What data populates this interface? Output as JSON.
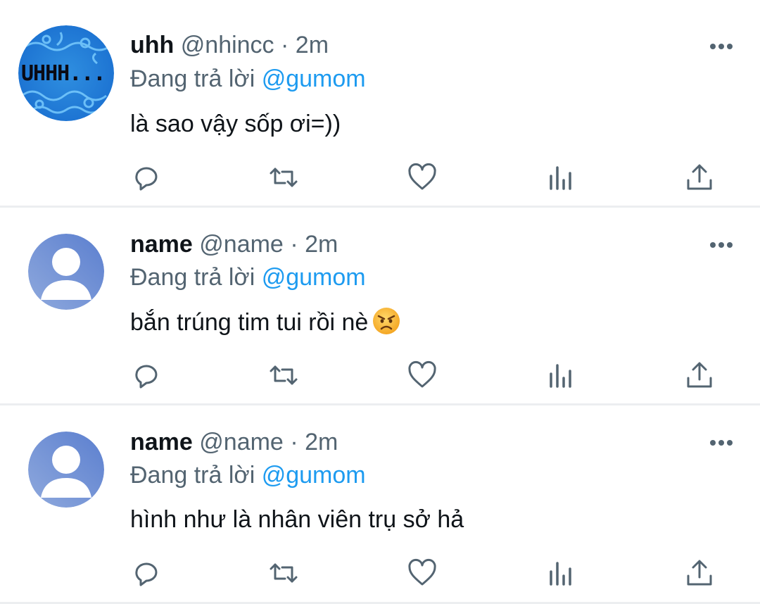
{
  "tweets": [
    {
      "display_name": "uhh",
      "handle": "@nhincc",
      "separator": "·",
      "time": "2m",
      "reply_prefix": "Đang trả lời",
      "reply_to": "@gumom",
      "text": "là sao vậy sốp ơi=))",
      "avatar": "uhhh-blue-pattern-avatar",
      "avatar_text": "UHHH..."
    },
    {
      "display_name": "name",
      "handle": "@name",
      "separator": "·",
      "time": "2m",
      "reply_prefix": "Đang trả lời",
      "reply_to": "@gumom",
      "text": "bắn trúng tim tui rồi nè",
      "emoji": "angry-face-emoji",
      "avatar": "default-avatar"
    },
    {
      "display_name": "name",
      "handle": "@name",
      "separator": "·",
      "time": "2m",
      "reply_prefix": "Đang trả lời",
      "reply_to": "@gumom",
      "text": "hình như là nhân viên trụ sở hả",
      "avatar": "default-avatar"
    }
  ],
  "icons": {
    "reply": "reply-icon",
    "retweet": "retweet-icon",
    "like": "like-icon",
    "views": "views-icon",
    "share": "share-icon",
    "more": "more-icon"
  },
  "colors": {
    "text": "#0f1419",
    "secondary": "#536471",
    "link": "#1d9bf0",
    "divider": "#eceef0",
    "avatar_gradient_start": "#8fa9dd",
    "avatar_gradient_end": "#5b7fcf"
  }
}
